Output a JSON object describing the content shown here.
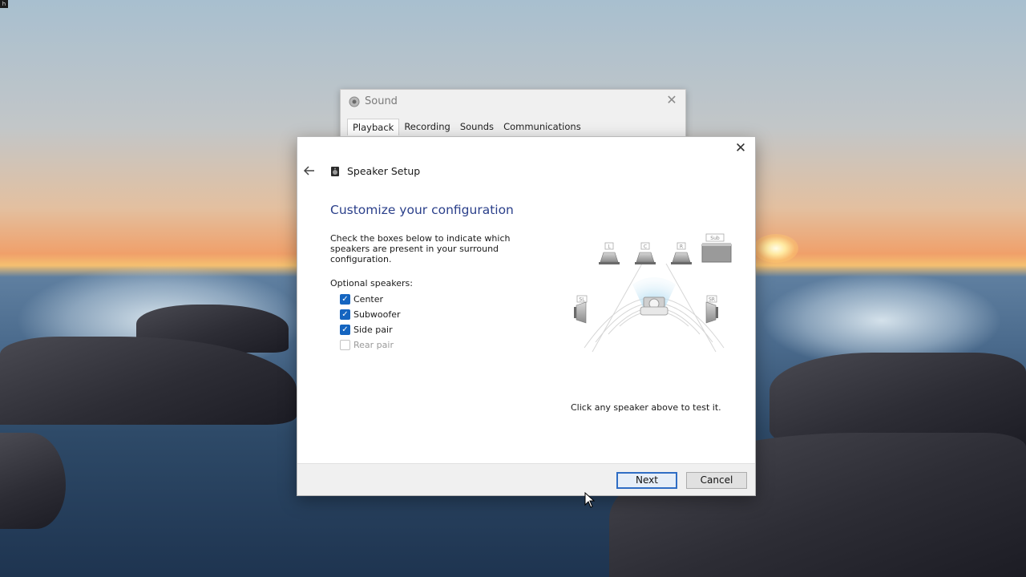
{
  "corner_tag": "h",
  "sound_window": {
    "title": "Sound",
    "tabs": [
      {
        "label": "Playback",
        "active": true
      },
      {
        "label": "Recording",
        "active": false
      },
      {
        "label": "Sounds",
        "active": false
      },
      {
        "label": "Communications",
        "active": false
      }
    ]
  },
  "speaker_setup": {
    "title": "Speaker Setup",
    "heading": "Customize your configuration",
    "instructions": "Check the boxes below to indicate which speakers are present in your surround configuration.",
    "optional_label": "Optional speakers:",
    "options": [
      {
        "label": "Center",
        "checked": true,
        "enabled": true
      },
      {
        "label": "Subwoofer",
        "checked": true,
        "enabled": true
      },
      {
        "label": "Side pair",
        "checked": true,
        "enabled": true
      },
      {
        "label": "Rear pair",
        "checked": false,
        "enabled": false
      }
    ],
    "speaker_labels": {
      "left": "L",
      "center": "C",
      "right": "R",
      "subwoofer": "Sub",
      "side_left": "SL",
      "side_right": "SR"
    },
    "test_hint": "Click any speaker above to test it.",
    "next_label": "Next",
    "cancel_label": "Cancel"
  },
  "colors": {
    "heading": "#2a3f8a",
    "checkbox": "#1565c0",
    "next_border": "#2f6dc4"
  }
}
